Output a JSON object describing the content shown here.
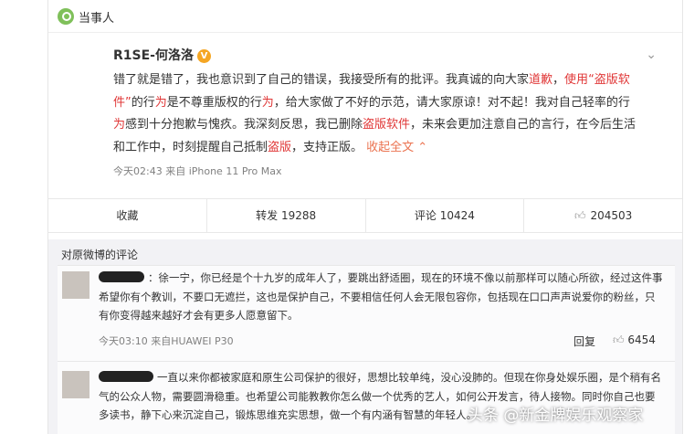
{
  "header": {
    "label": "当事人",
    "icon": "people-icon"
  },
  "post": {
    "author": "R1SE-何洛洛",
    "verified_badge": "V",
    "text_parts": [
      {
        "t": "错了就是错了，我也意识到了自己的错误，我接受所有的批评。我真诚的向大家",
        "c": "n"
      },
      {
        "t": "道歉",
        "c": "h"
      },
      {
        "t": "，",
        "c": "n"
      },
      {
        "t": "使用",
        "c": "h"
      },
      {
        "t": "“盗版软件”",
        "c": "h"
      },
      {
        "t": "的行",
        "c": "n"
      },
      {
        "t": "为",
        "c": "h"
      },
      {
        "t": "是不尊重版权的行",
        "c": "n"
      },
      {
        "t": "为",
        "c": "h"
      },
      {
        "t": "，给大家做了不好的示范，请大家原谅！对不起！我对自己轻率的行",
        "c": "n"
      },
      {
        "t": "为",
        "c": "h"
      },
      {
        "t": "感到十分抱歉与愧疚。我深刻反思，我已删除",
        "c": "n"
      },
      {
        "t": "盗版软件",
        "c": "h"
      },
      {
        "t": "，未来会更加注意自己的言行，在今后生活和工作中，时刻提醒自己抵制",
        "c": "n"
      },
      {
        "t": "盗版",
        "c": "h"
      },
      {
        "t": "，支持正版。",
        "c": "n"
      }
    ],
    "expand_label": "收起全文",
    "meta": "今天02:43 来自 iPhone 11 Pro Max"
  },
  "actions": {
    "collect": "收藏",
    "repost": "转发 19288",
    "comment": "评论 10424",
    "like": "204503"
  },
  "comments": {
    "header": "对原微博的评论",
    "items": [
      {
        "text": "：徐一宁，你已经是个十九岁的成年人了，要跳出舒适圈，现在的环境不像以前那样可以随心所欲，经过这件事希望你有个教训，不要口无遮拦，这也是保护自己，不要相信任何人会无限包容你，包括现在口口声声说爱你的粉丝，只有你变得越来越好才会有更多人愿意留下。",
        "meta": "今天03:10 来自HUAWEI P30",
        "reply": "回复",
        "likes": "6454"
      },
      {
        "text": "一直以来你都被家庭和原生公司保护的很好，思想比较单纯，没心没肺的。但现在你身处娱乐圈，是个稍有名气的公众人物，需要圆滑稳重。也希望公司能教教你怎么做一个优秀的艺人，如何公开发言，待人接物。同时你自己也要多读书，静下心来沉淀自己，锻炼思维充实思想，做一个有内涵有智慧的年轻人。"
      }
    ]
  },
  "watermark": "头条 @新金牌娱乐观察家"
}
